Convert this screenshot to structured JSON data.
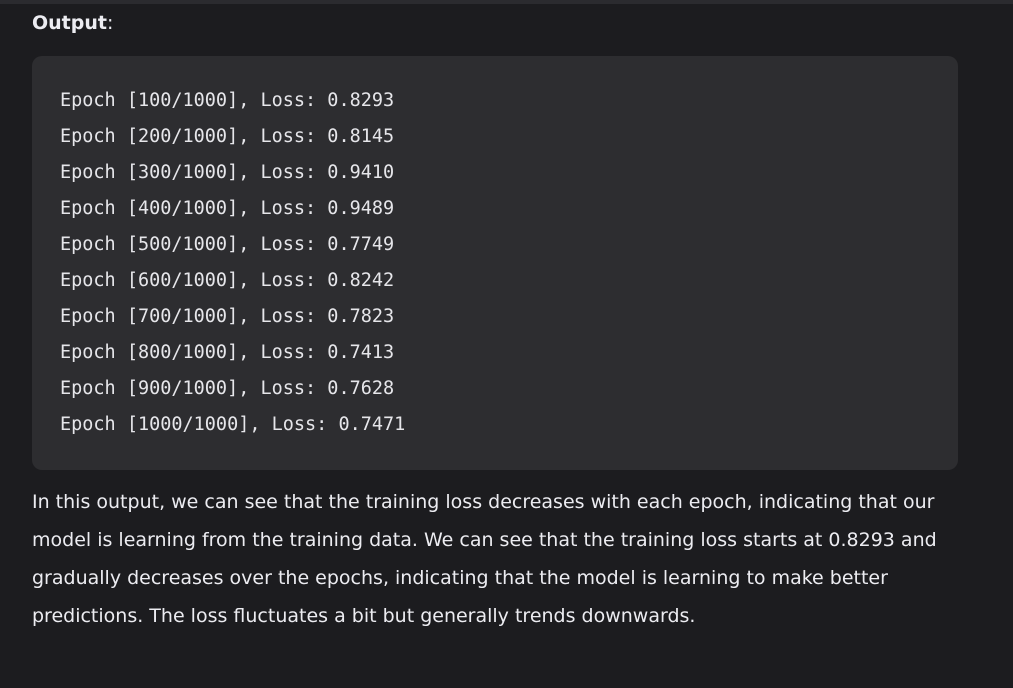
{
  "heading": {
    "label": "Output",
    "colon": ":"
  },
  "code_block": {
    "lines": [
      "Epoch [100/1000], Loss: 0.8293",
      "Epoch [200/1000], Loss: 0.8145",
      "Epoch [300/1000], Loss: 0.9410",
      "Epoch [400/1000], Loss: 0.9489",
      "Epoch [500/1000], Loss: 0.7749",
      "Epoch [600/1000], Loss: 0.8242",
      "Epoch [700/1000], Loss: 0.7823",
      "Epoch [800/1000], Loss: 0.7413",
      "Epoch [900/1000], Loss: 0.7628",
      "Epoch [1000/1000], Loss: 0.7471"
    ]
  },
  "explanation": {
    "text": "In this output, we can see that the training loss decreases with each epoch, indicating that our model is learning from the training data. We can see that the training loss starts at 0.8293 and gradually decreases over the epochs, indicating that the model is learning to make better predictions. The loss fluctuates a bit but generally trends downwards."
  },
  "colors": {
    "page_background": "#1c1c1f",
    "code_background": "#2d2d30",
    "text": "#ececf1"
  }
}
